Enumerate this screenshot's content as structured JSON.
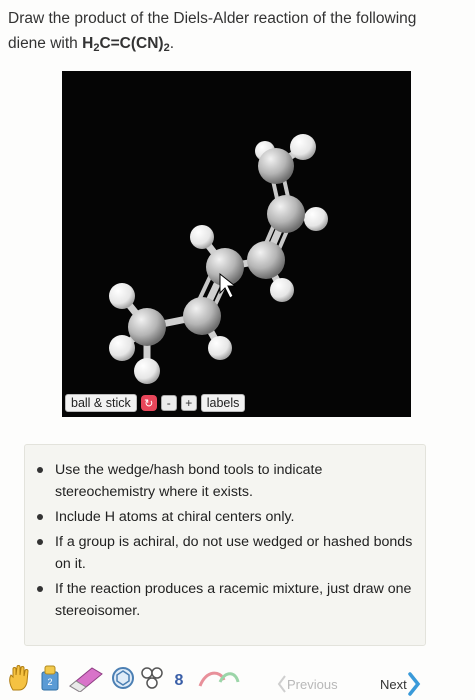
{
  "question": {
    "prefix": "Draw the product of the Diels-Alder reaction of the following diene with ",
    "formula_a": "H",
    "formula_sub1": "2",
    "formula_b": "C=C(CN)",
    "formula_sub2": "2",
    "suffix": "."
  },
  "viewer": {
    "mode_label": "ball & stick",
    "minus_label": "-",
    "plus_label": "+",
    "labels_label": "labels"
  },
  "instructions": [
    "Use the wedge/hash bond tools to indicate stereochemistry where it exists.",
    "Include H atoms at chiral centers only.",
    "If a group is achiral, do not use wedged or hashed bonds on it.",
    "If the reaction produces a racemic mixture, just draw one stereoisomer."
  ],
  "nav": {
    "previous_label": "Previous",
    "next_label": "Next"
  },
  "colors": {
    "accent": "#3a9ad9",
    "reset_button": "#e8465a"
  }
}
